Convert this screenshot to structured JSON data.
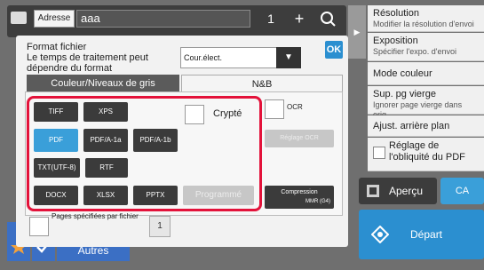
{
  "topbar": {
    "address_label": "Adresse",
    "address_value": "aaa",
    "copies": "1",
    "plus": "+"
  },
  "menu": [
    {
      "title": "Résolution",
      "sub": "Modifier la résolution d'envoi"
    },
    {
      "title": "Exposition",
      "sub": "Spécifier l'expo. d'envoi"
    },
    {
      "title": "Mode couleur",
      "sub": ""
    },
    {
      "title": "Sup. pg vierge",
      "sub": "Ignorer page vierge dans orig."
    },
    {
      "title": "Ajust. arrière plan",
      "sub": ""
    },
    {
      "title": "Réglage de l'obliquité du PDF",
      "sub": ""
    }
  ],
  "actions": {
    "preview": "Aperçu",
    "ca": "CA",
    "start": "Départ",
    "autres": "Autres"
  },
  "dialog": {
    "format_label": "Format fichier\nLe temps de traitement peut dépendre du format",
    "format_select": "Cour.élect.",
    "ok": "OK",
    "tabs": [
      "Couleur/Niveaux de gris",
      "N&B"
    ],
    "formats_row1": [
      "TIFF",
      "XPS"
    ],
    "formats_row2": [
      "PDF",
      "PDF/A-1a",
      "PDF/A-1b"
    ],
    "formats_row3": [
      "TXT(UTF-8)",
      "RTF"
    ],
    "formats_row4": [
      "DOCX",
      "XLSX",
      "PPTX",
      "Programmé"
    ],
    "crypted": "Crypté",
    "ocr": "OCR",
    "ocr_setting": "Réglage OCR",
    "compression": "Compression",
    "compression_value": "MMR (G4)",
    "pages_label": "Pages spécifiées par fichier",
    "pages_value": "1"
  },
  "colors": {
    "accent_blue": "#3a9fd9",
    "highlight_red": "#e3123a"
  }
}
